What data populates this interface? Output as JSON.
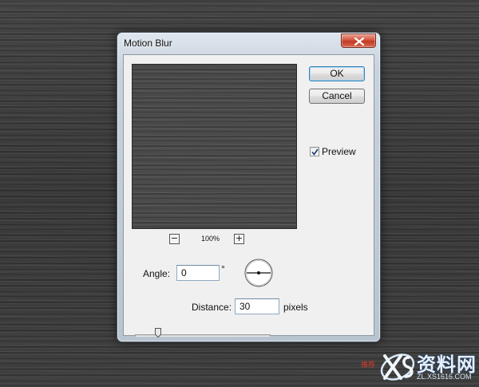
{
  "dialog": {
    "title": "Motion Blur",
    "ok_label": "OK",
    "cancel_label": "Cancel",
    "preview_label": "Preview",
    "preview_checked": true,
    "zoom_out_label": "−",
    "zoom_in_label": "+",
    "zoom_level": "100%",
    "angle_label": "Angle:",
    "angle_value": "0",
    "angle_unit": "°",
    "distance_label": "Distance:",
    "distance_value": "30",
    "distance_unit": "pixels",
    "distance_slider_fraction": 0.17
  },
  "watermark": {
    "red_text": "推荐",
    "brand_text": "资料网",
    "url_text": "ZL.XS1616.COM"
  },
  "icons": {
    "close": "close-icon",
    "check": "checkmark-icon",
    "angle": "angle-dial-icon",
    "slider": "slider-thumb-icon",
    "logo": "xs-logo-icon"
  }
}
